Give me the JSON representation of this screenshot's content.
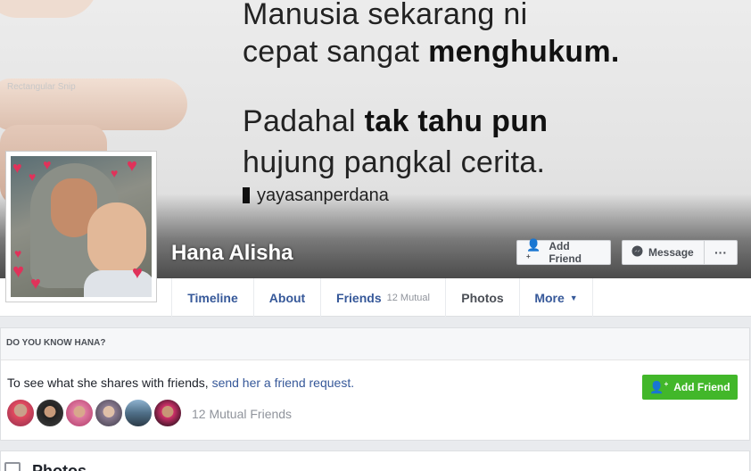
{
  "cover": {
    "snip_label": "Rectangular Snip",
    "quote": {
      "line1": "Manusia sekarang ni",
      "line2_plain": "cepat sangat ",
      "line2_bold": "menghukum.",
      "line3_plain": "Padahal ",
      "line3_bold": "tak tahu pun",
      "line4": "hujung pangkal cerita.",
      "brand": "yayasanperdana"
    }
  },
  "profile": {
    "name": "Hana Alisha",
    "add_friend_label": "Add Friend",
    "message_label": "Message",
    "more_label": "···"
  },
  "tabs": [
    {
      "label": "Timeline"
    },
    {
      "label": "About"
    },
    {
      "label": "Friends",
      "sub": "12 Mutual"
    },
    {
      "label": "Photos"
    },
    {
      "label": "More",
      "caret": "▼"
    }
  ],
  "know": {
    "heading": "DO YOU KNOW HANA?",
    "text_prefix": "To see what she shares with friends, ",
    "link": "send her a friend request.",
    "mutual_friends": "12 Mutual Friends",
    "add_friend_label": "Add Friend"
  },
  "bottom": {
    "title": "Photos"
  },
  "colors": {
    "link": "#365899",
    "green": "#42b72a",
    "bg": "#e9ebee"
  }
}
